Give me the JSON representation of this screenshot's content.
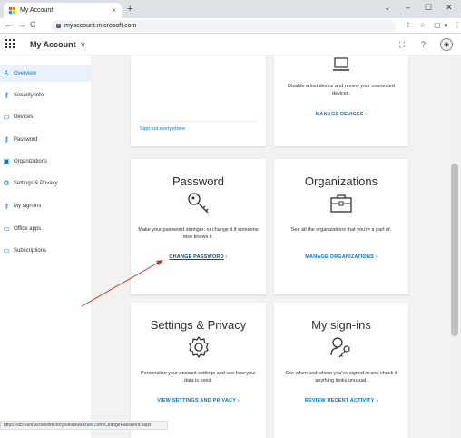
{
  "browser": {
    "tab_title": "My Account",
    "tab_close": "×",
    "new_tab": "+",
    "url": "myaccount.microsoft.com",
    "status_url": "https://account.activedirectory.windowsazure.com/ChangePassword.aspx",
    "win_min": "–",
    "win_max": "☐",
    "win_close": "✕",
    "win_chevron": "⌄"
  },
  "app": {
    "title": "My Account",
    "title_chevron": "∨",
    "help": "?"
  },
  "sidebar": {
    "items": [
      {
        "label": "Overview",
        "icon": "person-icon",
        "glyph": "♙",
        "active": true
      },
      {
        "label": "Security info",
        "icon": "security-info-icon",
        "glyph": "⚷",
        "active": false
      },
      {
        "label": "Devices",
        "icon": "laptop-icon",
        "glyph": "▭",
        "active": false
      },
      {
        "label": "Password",
        "icon": "key-icon",
        "glyph": "⚷",
        "active": false
      },
      {
        "label": "Organizations",
        "icon": "briefcase-icon",
        "glyph": "▣",
        "active": false
      },
      {
        "label": "Settings & Privacy",
        "icon": "gear-icon",
        "glyph": "⚙",
        "active": false
      },
      {
        "label": "My sign-ins",
        "icon": "sign-ins-icon",
        "glyph": "⚷",
        "active": false
      },
      {
        "label": "Office apps",
        "icon": "office-apps-icon",
        "glyph": "▭",
        "active": false
      },
      {
        "label": "Subscriptions",
        "icon": "subscriptions-icon",
        "glyph": "▭",
        "active": false
      }
    ]
  },
  "cards": {
    "security": {
      "link": "Sign out everywhere"
    },
    "devices": {
      "description": "Disable a lost device and review your connected devices.",
      "link": "MANAGE DEVICES",
      "icon": "laptop-icon"
    },
    "password": {
      "title": "Password",
      "description": "Make your password stronger, or change it if someone else knows it.",
      "link": "CHANGE PASSWORD",
      "icon": "key-icon"
    },
    "organizations": {
      "title": "Organizations",
      "description": "See all the organizations that you're a part of.",
      "link": "MANAGE ORGANIZATIONS",
      "icon": "briefcase-icon"
    },
    "settings": {
      "title": "Settings & Privacy",
      "description": "Personalize your account settings and see how your data is used.",
      "link": "VIEW SETTINGS AND PRIVACY",
      "icon": "gear-icon"
    },
    "signins": {
      "title": "My sign-ins",
      "description": "See when and where you've signed in and check if anything looks unusual.",
      "link": "REVIEW RECENT ACTIVITY",
      "icon": "sign-ins-icon"
    }
  },
  "link_arrow": "›",
  "colors": {
    "accent": "#0078d4",
    "annotation_arrow": "#c0392b",
    "content_bg": "#f3f2f1"
  }
}
